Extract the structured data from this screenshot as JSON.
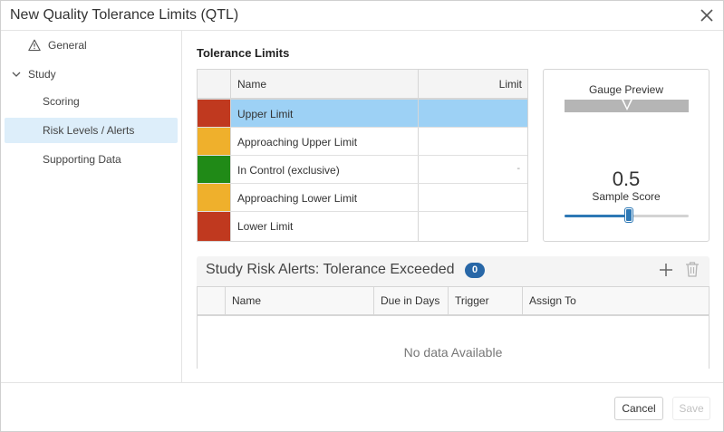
{
  "dialog": {
    "title": "New Quality Tolerance Limits (QTL)"
  },
  "icons": {
    "close": "close-icon",
    "warning": "warning-icon",
    "chevron": "chevron-down-icon",
    "add": "plus-icon",
    "delete": "trash-icon"
  },
  "sidebar": {
    "items": [
      {
        "label": "General",
        "icon": "warning-icon"
      },
      {
        "label": "Study",
        "icon": "chevron-down-icon"
      },
      {
        "label": "Scoring"
      },
      {
        "label": "Risk Levels / Alerts",
        "active": true
      },
      {
        "label": "Supporting Data"
      }
    ]
  },
  "tolerance": {
    "title": "Tolerance Limits",
    "columns": {
      "name": "Name",
      "limit": "Limit"
    },
    "rows": [
      {
        "name": "Upper Limit",
        "color": "#c0391f",
        "limit": "",
        "selected": true
      },
      {
        "name": "Approaching Upper Limit",
        "color": "#efb02c",
        "limit": ""
      },
      {
        "name": "In Control (exclusive)",
        "color": "#208a17",
        "limit": "-"
      },
      {
        "name": "Approaching Lower Limit",
        "color": "#efb02c",
        "limit": ""
      },
      {
        "name": "Lower Limit",
        "color": "#c0391f",
        "limit": ""
      }
    ]
  },
  "gauge": {
    "title": "Gauge Preview",
    "score": "0.5",
    "score_label": "Sample Score",
    "slider_fraction": 0.52
  },
  "alerts": {
    "title": "Study Risk Alerts: Tolerance Exceeded",
    "count": "0",
    "columns": [
      "Name",
      "Due in Days",
      "Trigger",
      "Assign To"
    ],
    "empty_message": "No data Available"
  },
  "footer": {
    "cancel_label": "Cancel",
    "save_label": "Save"
  },
  "colors": {
    "selected_row": "#9dd1f5",
    "active_nav": "#ddeefa",
    "accent": "#2d78b5",
    "badge": "#2867a7"
  }
}
